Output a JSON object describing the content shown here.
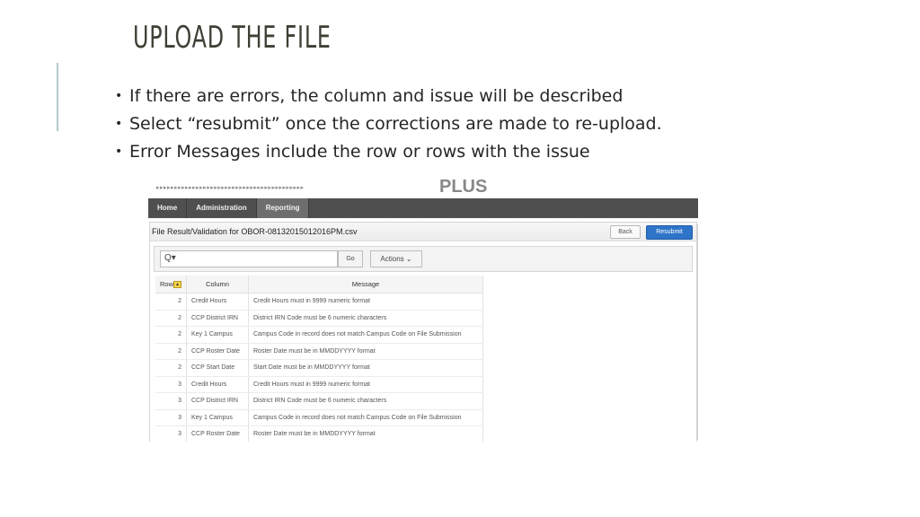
{
  "slide": {
    "title": "UPLOAD THE FILE",
    "bullets": [
      "If there are errors, the column and issue will be described",
      "Select “resubmit” once the corrections are made to re-upload.",
      "Error Messages include the row or rows with the issue"
    ],
    "bullet_glyph": "•"
  },
  "screenshot": {
    "banner": {
      "arrows": "▸▸▸▸▸▸▸▸▸▸▸▸▸▸▸▸▸▸▸▸▸▸▸▸▸▸▸▸▸▸▸▸▸▸▸▸▸▸▸▸▸",
      "logo_text": "PLUS"
    },
    "nav": {
      "tabs": [
        {
          "label": "Home",
          "active": false
        },
        {
          "label": "Administration",
          "active": false
        },
        {
          "label": "Reporting",
          "active": true
        }
      ]
    },
    "region": {
      "title": "File Result/Validation for OBOR-08132015012016PM.csv",
      "back_label": "Back",
      "resubmit_label": "Resubmit",
      "resubmit_color": "#2e74c9"
    },
    "toolbar": {
      "search_icon": "Q▾",
      "search_value": "",
      "go_label": "Go",
      "actions_label": "Actions ⌄"
    },
    "table": {
      "headers": {
        "row": "Row",
        "column": "Column",
        "message": "Message"
      },
      "sort_icon": "▲",
      "rows": [
        {
          "row": "2",
          "column": "Credit Hours",
          "message": "Credit Hours must in 9999 numeric format"
        },
        {
          "row": "2",
          "column": "CCP District IRN",
          "message": "District IRN Code must be 6 numeric characters"
        },
        {
          "row": "2",
          "column": "Key 1 Campus",
          "message": "Campus Code in record does not match Campus Code on File Submission"
        },
        {
          "row": "2",
          "column": "CCP Roster Date",
          "message": "Roster Date must be in MMDDYYYY format"
        },
        {
          "row": "2",
          "column": "CCP Start Date",
          "message": "Start Date must be in MMDDYYYY format"
        },
        {
          "row": "3",
          "column": "Credit Hours",
          "message": "Credit Hours must in 9999 numeric format"
        },
        {
          "row": "3",
          "column": "CCP District IRN",
          "message": "District IRN Code must be 6 numeric characters"
        },
        {
          "row": "3",
          "column": "Key 1 Campus",
          "message": "Campus Code in record does not match Campus Code on File Submission"
        },
        {
          "row": "3",
          "column": "CCP Roster Date",
          "message": "Roster Date must be in MMDDYYYY format"
        },
        {
          "row": "",
          "column": "",
          "message": ""
        }
      ]
    }
  }
}
